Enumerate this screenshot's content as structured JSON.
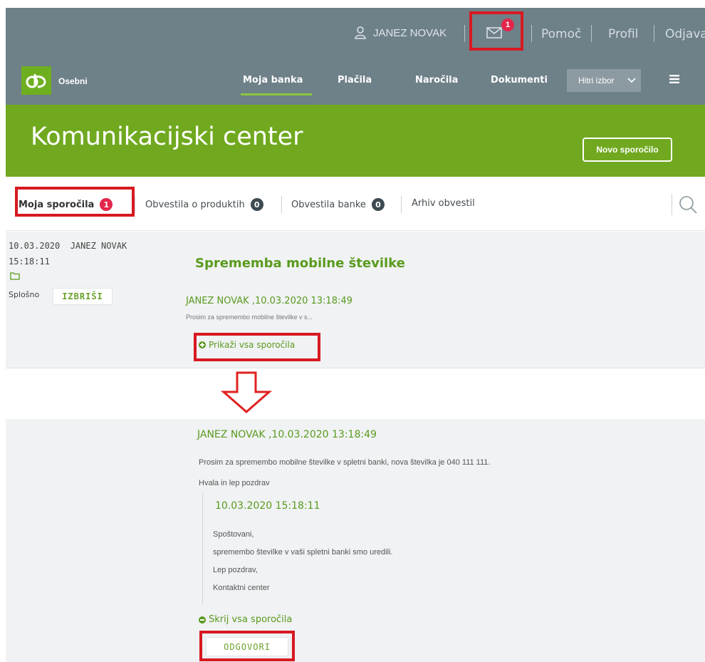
{
  "header": {
    "user_name": "JANEZ NOVAK",
    "mail_count": "1",
    "links": [
      "Pomoč",
      "Profil",
      "Odjava"
    ],
    "brand": "Osebni",
    "nav": [
      "Moja banka",
      "Plačila",
      "Naročila",
      "Dokumenti"
    ],
    "quick_select": "Hitri izbor"
  },
  "hero": {
    "title": "Komunikacijski center",
    "new_message": "Novo sporočilo"
  },
  "tabs": [
    {
      "label": "Moja sporočila",
      "count": "1"
    },
    {
      "label": "Obvestila o produktih",
      "count": "0"
    },
    {
      "label": "Obvestila banke",
      "count": "0"
    },
    {
      "label": "Arhiv obvestil",
      "count": ""
    }
  ],
  "message": {
    "date": "10.03.2020",
    "sender": "JANEZ NOVAK",
    "time": "15:18:11",
    "category": "Splošno",
    "delete_label": "IZBRIŠI",
    "title": "Sprememba mobilne številke",
    "author_line": "JANEZ NOVAK ,10.03.2020 13:18:49",
    "preview": "Prosim za spremembo mobilne številke v s...",
    "show_all": "Prikaži vsa sporočila"
  },
  "thread": {
    "author_line": "JANEZ NOVAK ,10.03.2020 13:18:49",
    "body_1": "Prosim za spremembo mobilne številke v spletni banki, nova številka je 040 111 111.",
    "body_2": "Hvala in lep pozdrav",
    "reply_date": "10.03.2020 15:18:11",
    "reply_lines": [
      "Spoštovani,",
      "spremembo številke v vaši spletni banki smo uredili.",
      "Lep pozdrav,",
      "Kontaktni center"
    ],
    "hide_all": "Skrij vsa sporočila",
    "reply_label": "ODGOVORI"
  },
  "colors": {
    "topbar": "#6e8088",
    "brand_green": "#70a91f",
    "highlight_red": "#d71920",
    "badge_red": "#e4264b"
  },
  "icons": [
    "user-icon",
    "mail-icon",
    "menu-icon",
    "search-icon",
    "folder-icon",
    "arrow-down-icon"
  ]
}
